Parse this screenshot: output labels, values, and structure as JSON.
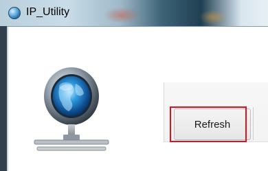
{
  "window": {
    "title": "IP_Utility"
  },
  "toolbar": {
    "refresh_label": "Refresh"
  },
  "icons": {
    "app_icon": "globe-icon",
    "network_icon": "network-globe-icon"
  },
  "colors": {
    "highlight": "#e0101e",
    "titlebar_dark": "#1f3f52"
  }
}
